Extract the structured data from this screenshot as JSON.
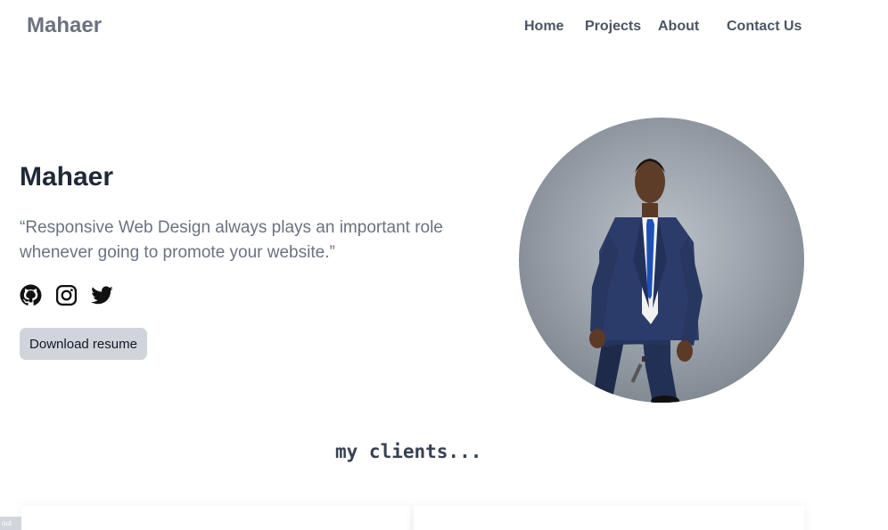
{
  "header": {
    "brand": "Mahaer",
    "nav": {
      "home": "Home",
      "projects": "Projects",
      "about": "About",
      "contact": "Contact Us"
    }
  },
  "hero": {
    "name": "Mahaer",
    "quote": "“Responsive Web Design always plays an important role whenever going to promote your website.”",
    "social": [
      "github-icon",
      "instagram-icon",
      "twitter-icon"
    ],
    "resume_button": "Download resume",
    "portrait_alt": "Portrait of Mahaer"
  },
  "clients": {
    "title": "my clients..."
  },
  "corner_tag": "out",
  "colors": {
    "brand": "#6b7280",
    "heading": "#1f2937",
    "quote": "#6b7280",
    "button_bg": "#d1d5db"
  }
}
